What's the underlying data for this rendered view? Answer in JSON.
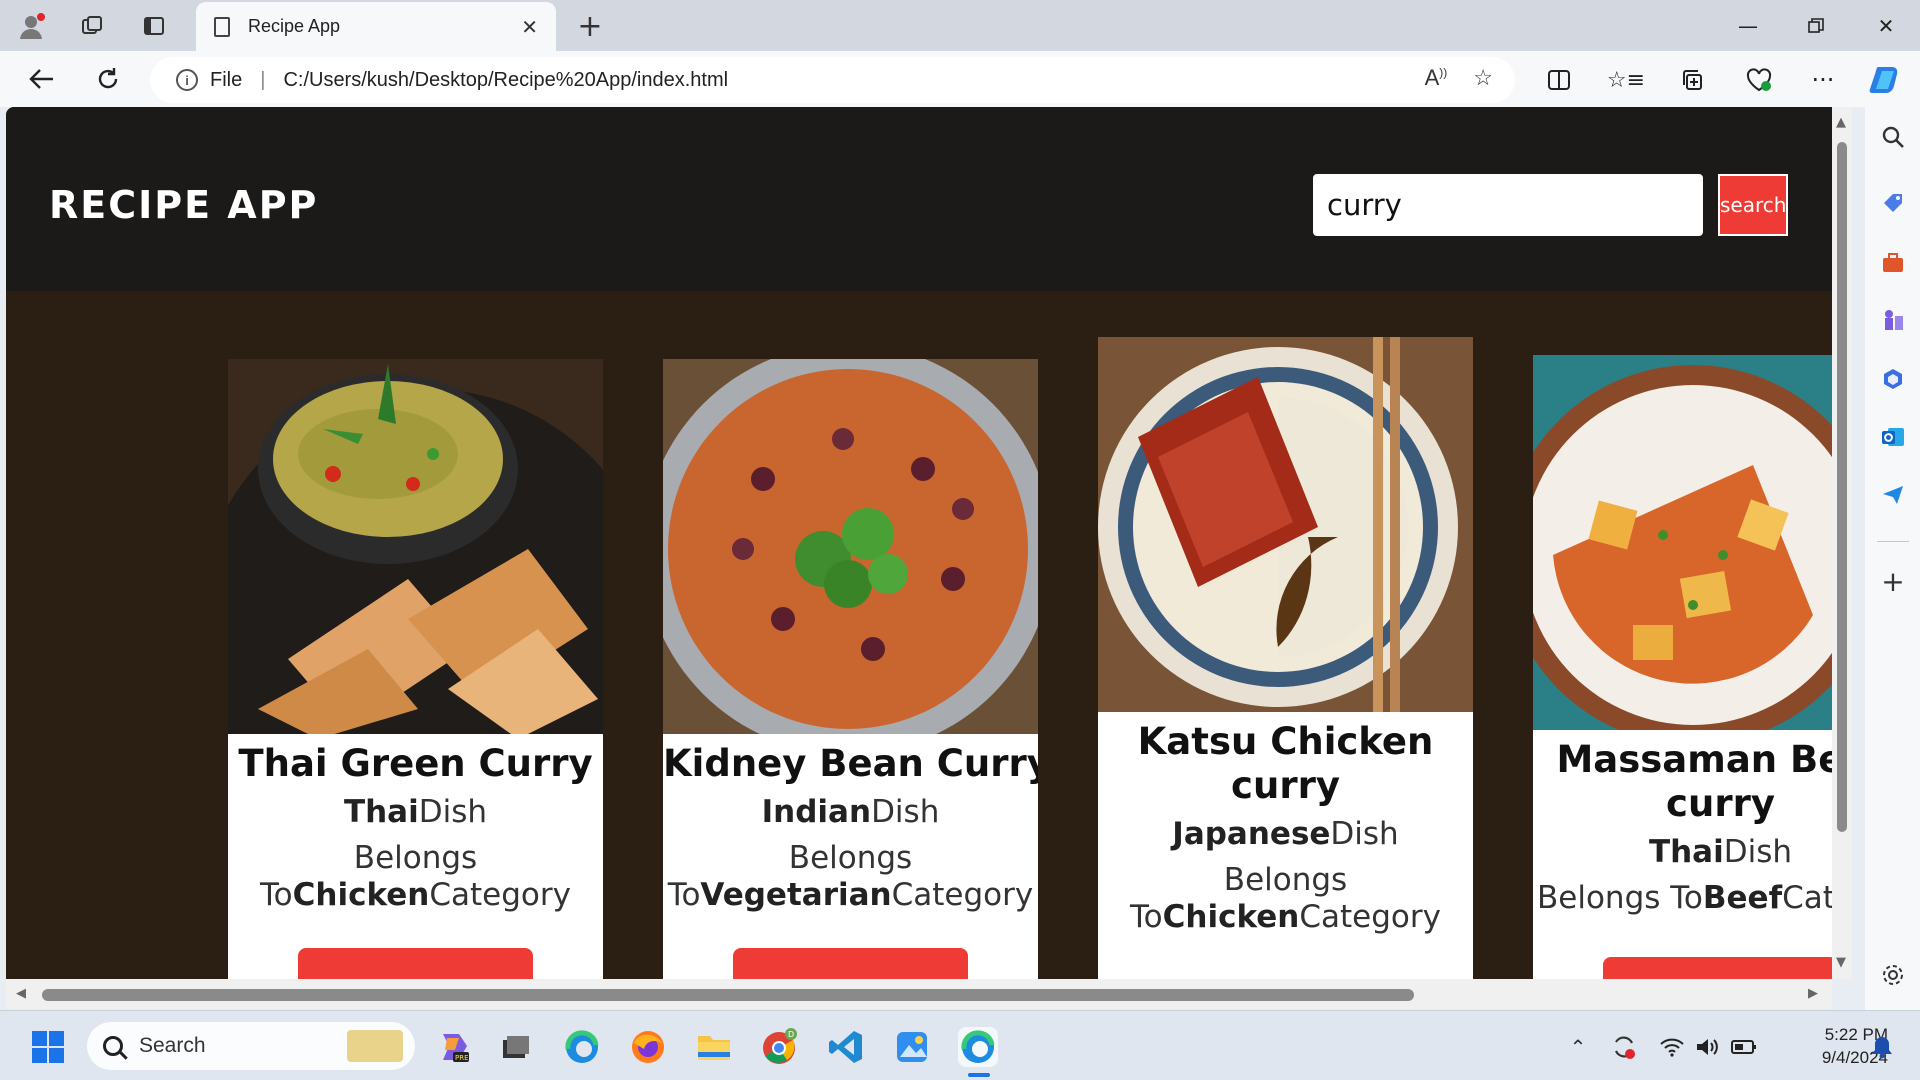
{
  "browser": {
    "tab_title": "Recipe App",
    "address_prefix": "File",
    "address_url": "C:/Users/kush/Desktop/Recipe%20App/index.html"
  },
  "app": {
    "title": "RECIPE APP",
    "search_value": "curry",
    "search_button": "search"
  },
  "recipes": [
    {
      "name": "Thai Green Curry",
      "cuisine": "Thai",
      "dish_suffix": "Dish",
      "belongs_prefix": "Belongs To",
      "category": "Chicken",
      "category_suffix": "Category"
    },
    {
      "name": "Kidney Bean Curry",
      "cuisine": "Indian",
      "dish_suffix": "Dish",
      "belongs_prefix": "Belongs To",
      "category": "Vegetarian",
      "category_suffix": "Category"
    },
    {
      "name": "Katsu Chicken curry",
      "cuisine": "Japanese",
      "dish_suffix": "Dish",
      "belongs_prefix": "Belongs To",
      "category": "Chicken",
      "category_suffix": "Category"
    },
    {
      "name": "Massaman Beef curry",
      "cuisine": "Thai",
      "dish_suffix": "Dish",
      "belongs_prefix": "Belongs To",
      "category": "Beef",
      "category_suffix": "Category"
    }
  ],
  "taskbar": {
    "search_placeholder": "Search",
    "time": "5:22 PM",
    "date": "9/4/2024"
  },
  "colors": {
    "accent_red": "#ef3b35",
    "header_bg": "#1c1a18",
    "page_bg": "#2a1f12"
  }
}
